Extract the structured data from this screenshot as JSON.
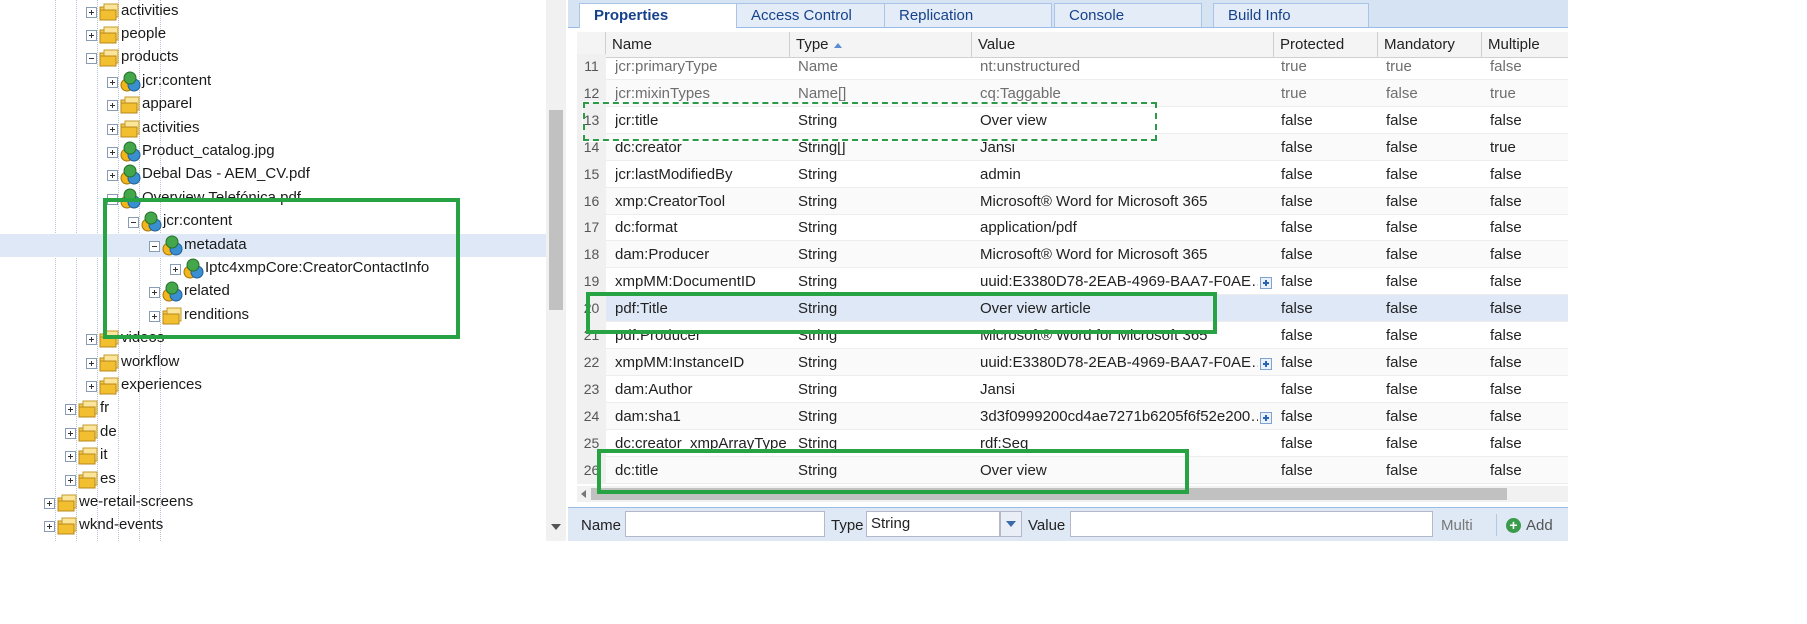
{
  "tree": {
    "nodes": [
      {
        "label": "activities",
        "icon": "folder-icon",
        "toggle": "plus"
      },
      {
        "label": "people",
        "icon": "folder-icon",
        "toggle": "plus"
      },
      {
        "label": "products",
        "icon": "folder-icon",
        "toggle": "minus"
      },
      {
        "label": "jcr:content",
        "icon": "node-icon",
        "toggle": "plus"
      },
      {
        "label": "apparel",
        "icon": "folder-icon",
        "toggle": "plus"
      },
      {
        "label": "activities",
        "icon": "folder-icon",
        "toggle": "plus"
      },
      {
        "label": "Product_catalog.jpg",
        "icon": "node-icon",
        "toggle": "plus"
      },
      {
        "label": "Debal Das - AEM_CV.pdf",
        "icon": "node-icon",
        "toggle": "plus"
      },
      {
        "label": "Overview Telefónica.pdf",
        "icon": "node-icon",
        "toggle": "minus"
      },
      {
        "label": "jcr:content",
        "icon": "node-icon",
        "toggle": "minus"
      },
      {
        "label": "metadata",
        "icon": "node-icon",
        "toggle": "minus",
        "selected": true
      },
      {
        "label": "Iptc4xmpCore:CreatorContactInfo",
        "icon": "node-icon",
        "toggle": "plus"
      },
      {
        "label": "related",
        "icon": "node-icon",
        "toggle": "plus"
      },
      {
        "label": "renditions",
        "icon": "folder-icon",
        "toggle": "plus"
      },
      {
        "label": "videos",
        "icon": "folder-icon",
        "toggle": "plus"
      },
      {
        "label": "workflow",
        "icon": "folder-icon",
        "toggle": "plus"
      },
      {
        "label": "experiences",
        "icon": "folder-icon",
        "toggle": "plus"
      },
      {
        "label": "fr",
        "icon": "folder-icon",
        "toggle": "plus"
      },
      {
        "label": "de",
        "icon": "folder-icon",
        "toggle": "plus"
      },
      {
        "label": "it",
        "icon": "folder-icon",
        "toggle": "plus"
      },
      {
        "label": "es",
        "icon": "folder-icon",
        "toggle": "plus"
      },
      {
        "label": "we-retail-screens",
        "icon": "folder-icon",
        "toggle": "plus"
      },
      {
        "label": "wknd-events",
        "icon": "folder-icon",
        "toggle": "plus"
      }
    ]
  },
  "tabs": [
    {
      "label": "Properties",
      "active": true
    },
    {
      "label": "Access Control"
    },
    {
      "label": "Replication"
    },
    {
      "label": "Console"
    },
    {
      "label": "Build Info"
    }
  ],
  "grid": {
    "columns": [
      "Name",
      "Type",
      "Value",
      "Protected",
      "Mandatory",
      "Multiple"
    ],
    "sorted_column": "Type",
    "rows": [
      {
        "num": "11",
        "name": "jcr:primaryType",
        "type": "Name",
        "value": "nt:unstructured",
        "protected": "true",
        "mandatory": "true",
        "multiple": "false",
        "muted": true
      },
      {
        "num": "12",
        "name": "jcr:mixinTypes",
        "type": "Name[]",
        "value": "cq:Taggable",
        "protected": "true",
        "mandatory": "false",
        "multiple": "true",
        "muted": true
      },
      {
        "num": "13",
        "name": "jcr:title",
        "type": "String",
        "value": "Over view",
        "protected": "false",
        "mandatory": "false",
        "multiple": "false"
      },
      {
        "num": "14",
        "name": "dc:creator",
        "type": "String[]",
        "value": "Jansi",
        "protected": "false",
        "mandatory": "false",
        "multiple": "true"
      },
      {
        "num": "15",
        "name": "jcr:lastModifiedBy",
        "type": "String",
        "value": "admin",
        "protected": "false",
        "mandatory": "false",
        "multiple": "false"
      },
      {
        "num": "16",
        "name": "xmp:CreatorTool",
        "type": "String",
        "value": "Microsoft® Word for Microsoft 365",
        "protected": "false",
        "mandatory": "false",
        "multiple": "false"
      },
      {
        "num": "17",
        "name": "dc:format",
        "type": "String",
        "value": "application/pdf",
        "protected": "false",
        "mandatory": "false",
        "multiple": "false"
      },
      {
        "num": "18",
        "name": "dam:Producer",
        "type": "String",
        "value": "Microsoft® Word for Microsoft 365",
        "protected": "false",
        "mandatory": "false",
        "multiple": "false"
      },
      {
        "num": "19",
        "name": "xmpMM:DocumentID",
        "type": "String",
        "value": "uuid:E3380D78-2EAB-4969-BAA7-F0AE…",
        "protected": "false",
        "mandatory": "false",
        "multiple": "false",
        "expand": true
      },
      {
        "num": "20",
        "name": "pdf:Title",
        "type": "String",
        "value": "Over view article",
        "protected": "false",
        "mandatory": "false",
        "multiple": "false",
        "selected": true
      },
      {
        "num": "21",
        "name": "pdf:Producer",
        "type": "String",
        "value": "Microsoft® Word for Microsoft 365",
        "protected": "false",
        "mandatory": "false",
        "multiple": "false"
      },
      {
        "num": "22",
        "name": "xmpMM:InstanceID",
        "type": "String",
        "value": "uuid:E3380D78-2EAB-4969-BAA7-F0AE…",
        "protected": "false",
        "mandatory": "false",
        "multiple": "false",
        "expand": true
      },
      {
        "num": "23",
        "name": "dam:Author",
        "type": "String",
        "value": "Jansi",
        "protected": "false",
        "mandatory": "false",
        "multiple": "false"
      },
      {
        "num": "24",
        "name": "dam:sha1",
        "type": "String",
        "value": "3d3f0999200cd4ae7271b6205f6f52e200…",
        "protected": "false",
        "mandatory": "false",
        "multiple": "false",
        "expand": true
      },
      {
        "num": "25",
        "name": "dc:creator_xmpArrayType",
        "type": "String",
        "value": "rdf:Seq",
        "protected": "false",
        "mandatory": "false",
        "multiple": "false"
      },
      {
        "num": "26",
        "name": "dc:title",
        "type": "String",
        "value": "Over view",
        "protected": "false",
        "mandatory": "false",
        "multiple": "false"
      }
    ]
  },
  "bottom_bar": {
    "name_label": "Name",
    "name_value": "",
    "type_label": "Type",
    "type_value": "String",
    "value_label": "Value",
    "value_value": "",
    "multi_label": "Multi",
    "add_label": "Add"
  },
  "colors": {
    "highlight": "#27a344",
    "tab_text": "#15428b",
    "selection": "#dfe8f6"
  }
}
